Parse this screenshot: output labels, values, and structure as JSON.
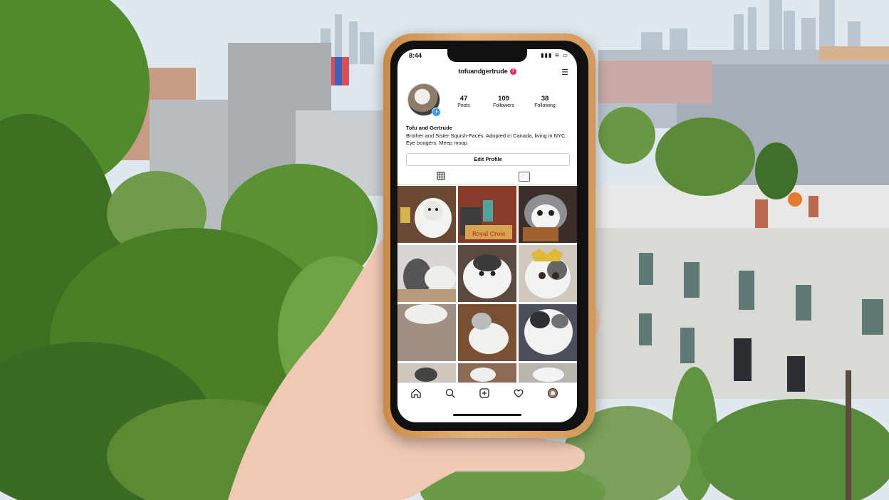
{
  "status_bar": {
    "time": "8:44",
    "icons": "▮▮▮ ≋ ▭"
  },
  "profile": {
    "username": "tofuandgertrude",
    "notification_count": "1",
    "posts_count": "47",
    "posts_label": "Posts",
    "followers_count": "109",
    "followers_label": "Followers",
    "following_count": "38",
    "following_label": "Following",
    "display_name": "Tofu and Gertrude",
    "bio": "Brother and Sister Squish-Faces. Adopted in Canada, living in NYC. Eye boogers. Meep moop.",
    "edit_button": "Edit Profile"
  },
  "icons": {
    "menu": "hamburger-menu-icon",
    "grid_tab": "grid-icon",
    "tagged_tab": "tagged-icon",
    "home": "home-icon",
    "search": "search-icon",
    "new_post": "add-post-icon",
    "activity": "heart-icon",
    "profile": "profile-avatar-icon"
  },
  "colors": {
    "accent": "#3897f0",
    "badge": "#e0245e",
    "phone_case": "#d9a261"
  }
}
